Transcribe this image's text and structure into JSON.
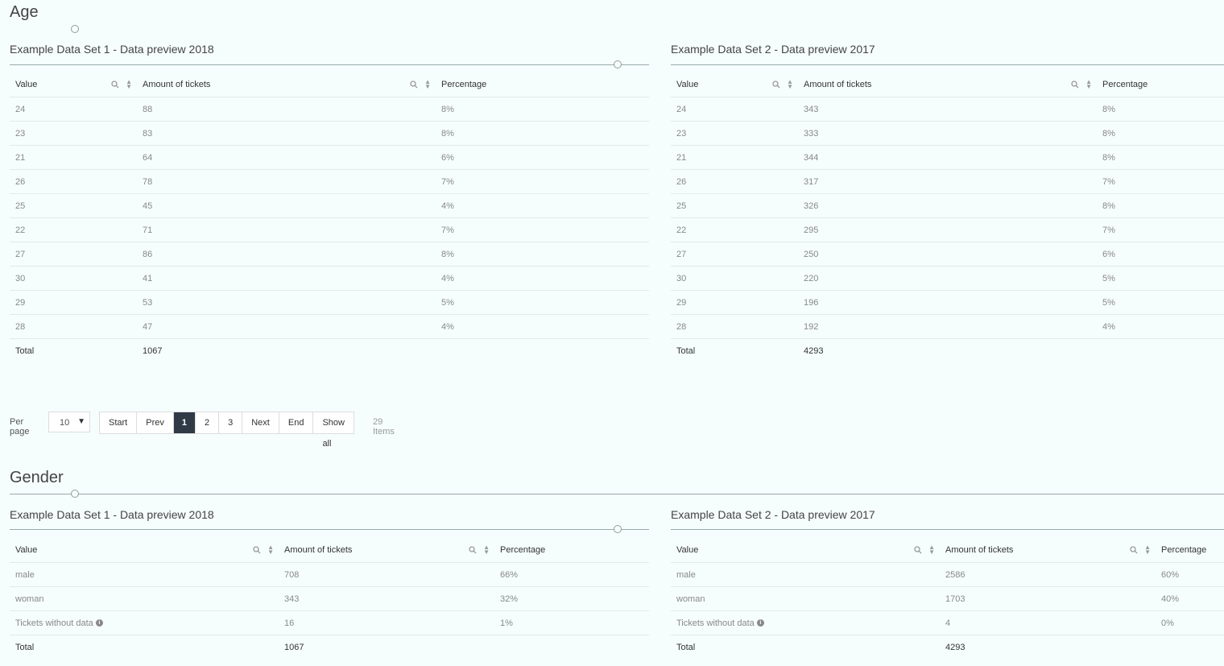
{
  "age": {
    "title": "Age",
    "left": {
      "title": "Example Data Set 1 - Data preview 2018",
      "headers": [
        "Value",
        "Amount of tickets",
        "Percentage"
      ],
      "rows": [
        [
          "24",
          "88",
          "8%"
        ],
        [
          "23",
          "83",
          "8%"
        ],
        [
          "21",
          "64",
          "6%"
        ],
        [
          "26",
          "78",
          "7%"
        ],
        [
          "25",
          "45",
          "4%"
        ],
        [
          "22",
          "71",
          "7%"
        ],
        [
          "27",
          "86",
          "8%"
        ],
        [
          "30",
          "41",
          "4%"
        ],
        [
          "29",
          "53",
          "5%"
        ],
        [
          "28",
          "47",
          "4%"
        ]
      ],
      "total": [
        "Total",
        "1067",
        ""
      ]
    },
    "right": {
      "title": "Example Data Set 2 - Data preview 2017",
      "headers": [
        "Value",
        "Amount of tickets",
        "Percentage"
      ],
      "rows": [
        [
          "24",
          "343",
          "8%"
        ],
        [
          "23",
          "333",
          "8%"
        ],
        [
          "21",
          "344",
          "8%"
        ],
        [
          "26",
          "317",
          "7%"
        ],
        [
          "25",
          "326",
          "8%"
        ],
        [
          "22",
          "295",
          "7%"
        ],
        [
          "27",
          "250",
          "6%"
        ],
        [
          "30",
          "220",
          "5%"
        ],
        [
          "29",
          "196",
          "5%"
        ],
        [
          "28",
          "192",
          "4%"
        ]
      ],
      "total": [
        "Total",
        "4293",
        ""
      ]
    },
    "pager": {
      "per_page_label": "Per page",
      "per_page_value": "10",
      "buttons": [
        "Start",
        "Prev",
        "1",
        "2",
        "3",
        "Next",
        "End",
        "Show all"
      ],
      "active_page": "1",
      "items_label": "29 Items"
    }
  },
  "gender": {
    "title": "Gender",
    "left": {
      "title": "Example Data Set 1 - Data preview 2018",
      "headers": [
        "Value",
        "Amount of tickets",
        "Percentage"
      ],
      "rows": [
        [
          "male",
          "708",
          "66%"
        ],
        [
          "woman",
          "343",
          "32%"
        ],
        [
          "Tickets without data",
          "16",
          "1%"
        ]
      ],
      "total": [
        "Total",
        "1067",
        ""
      ]
    },
    "right": {
      "title": "Example Data Set 2 - Data preview 2017",
      "headers": [
        "Value",
        "Amount of tickets",
        "Percentage"
      ],
      "rows": [
        [
          "male",
          "2586",
          "60%"
        ],
        [
          "woman",
          "1703",
          "40%"
        ],
        [
          "Tickets without data",
          "4",
          "0%"
        ]
      ],
      "total": [
        "Total",
        "4293",
        ""
      ]
    }
  },
  "icons": {
    "search": "search-icon",
    "sort": "sort-icon",
    "info": "info-icon"
  },
  "colors": {
    "background": "#f6fdfd",
    "active_page": "#2f3a46"
  }
}
